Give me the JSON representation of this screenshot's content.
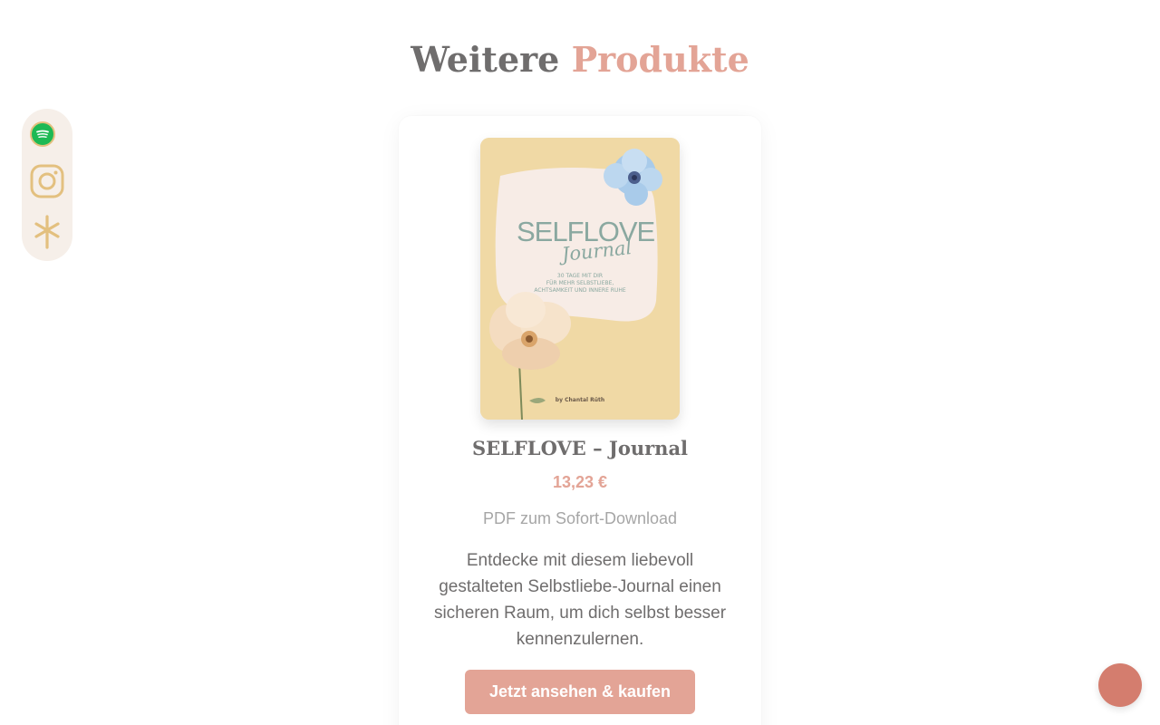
{
  "section": {
    "title_part_1": "Weitere",
    "title_part_2": "Produkte"
  },
  "social": [
    {
      "icon": "spotify-icon"
    },
    {
      "icon": "instagram-icon"
    },
    {
      "icon": "linktree-icon"
    }
  ],
  "product": {
    "cover": {
      "title": "SELFLOVE",
      "script": "Journal",
      "subtitle_lines": [
        "30 TAGE MIT DIR",
        "FÜR MEHR SELBSTLIEBE,",
        "ACHTSAMKEIT UND INNERE RUHE"
      ],
      "author": "by Chantal Rüth"
    },
    "name": "SELFLOVE – Journal",
    "price": "13,23 €",
    "format": "PDF zum Sofort-Download",
    "description": "Entdecke mit diesem liebevoll gestalteten Selbstliebe-Journal einen sicheren Raum, um dich selbst besser kennenzulernen.",
    "button_label": "Jetzt ansehen & kaufen"
  },
  "colors": {
    "accent": "#e3a496",
    "heading_gray": "#6f6d6d",
    "fab": "#d47d6e",
    "sidebar_bg": "#f6efe9",
    "icon_gold": "#e3c07f",
    "spotify_green": "#1db954"
  }
}
